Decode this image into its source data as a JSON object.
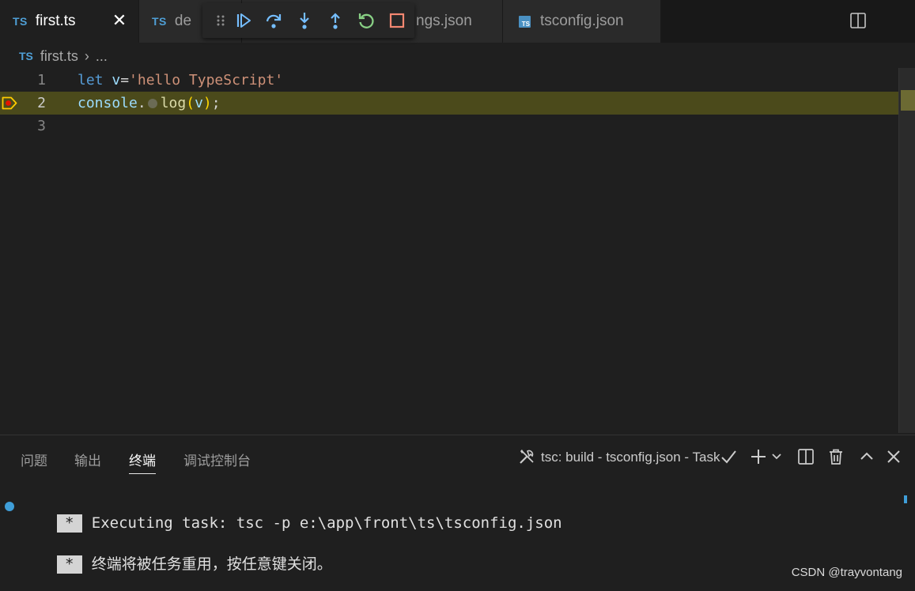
{
  "tabs": [
    {
      "lang": "TS",
      "label": "first.ts",
      "active": true
    },
    {
      "lang": "TS",
      "label": "de"
    },
    {
      "lang": "",
      "label": "ngs.json"
    },
    {
      "lang": "TS",
      "label": "tsconfig.json"
    }
  ],
  "tab_close_symbol": "✕",
  "breadcrumb": {
    "lang": "TS",
    "file": "first.ts",
    "sep": "›",
    "rest": "..."
  },
  "editor": {
    "line_numbers": [
      "1",
      "2",
      "3"
    ],
    "line1": {
      "kw": "let",
      "var": " v",
      "eq": "=",
      "str": "'hello TypeScript'"
    },
    "line2": {
      "obj": "console",
      "dot": ".",
      "fn": "log",
      "open": "(",
      "arg": "v",
      "close": ")",
      "semi": ";"
    },
    "current_line": 2
  },
  "panel": {
    "tabs": [
      "问题",
      "输出",
      "终端",
      "调试控制台"
    ],
    "active_tab": "终端",
    "task_label": "tsc: build - tsconfig.json - Task",
    "terminal_lines": [
      {
        "prefix": "*",
        "text": "Executing task: tsc -p e:\\app\\front\\ts\\tsconfig.json"
      },
      {
        "prefix": "*",
        "text": "终端将被任务重用，按任意键关闭。"
      }
    ]
  },
  "watermark": "CSDN @trayvontang",
  "icons": {
    "debug": [
      "grip-icon",
      "continue-icon",
      "step-over-icon",
      "step-into-icon",
      "step-out-icon",
      "restart-icon",
      "stop-icon"
    ],
    "panel": [
      "tools-icon",
      "check-icon",
      "plus-icon",
      "chevron-down-icon",
      "split-terminal-icon",
      "trash-icon",
      "chevron-up-icon",
      "close-panel-icon"
    ]
  },
  "colors": {
    "accent_blue": "#4f9fd6",
    "debug_blue": "#75beff",
    "restart_green": "#89d185",
    "stop_red": "#f48771",
    "current_line": "#4b4a1b",
    "breakpoint": "#ffcc00"
  }
}
